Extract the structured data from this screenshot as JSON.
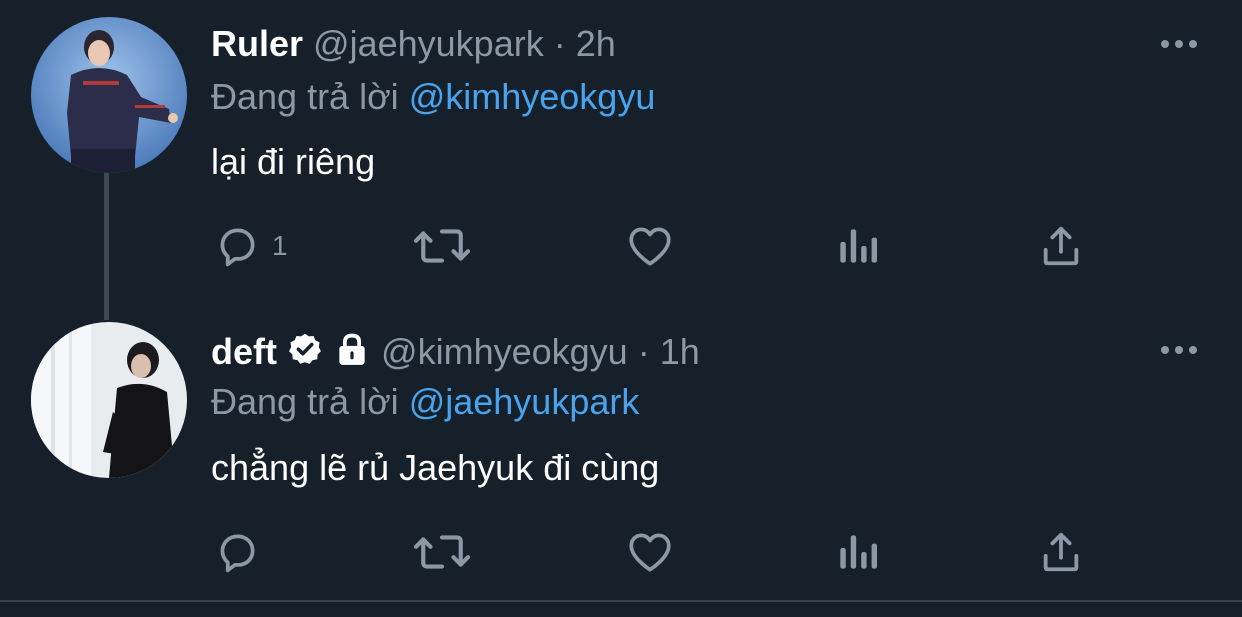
{
  "tweets": [
    {
      "name": "Ruler",
      "handle": "@jaehyukpark",
      "separator": "·",
      "time": "2h",
      "reply_prefix": "Đang trả lời",
      "reply_to": "@kimhyeokgyu",
      "text": "lại đi riêng",
      "reply_count": "1",
      "verified": false,
      "protected": false
    },
    {
      "name": "deft",
      "handle": "@kimhyeokgyu",
      "separator": "·",
      "time": "1h",
      "reply_prefix": "Đang trả lời",
      "reply_to": "@jaehyukpark",
      "text": "chẳng lẽ rủ Jaehyuk đi cùng",
      "reply_count": "",
      "verified": true,
      "protected": true
    }
  ],
  "icons": {
    "reply": "reply-icon",
    "retweet": "retweet-icon",
    "like": "heart-icon",
    "views": "views-icon",
    "share": "share-icon",
    "more": "more-icon"
  },
  "colors": {
    "background": "#15202b",
    "secondary_text": "#8b98a5",
    "mention": "#4aa3ed",
    "thread_line": "#3d4a56"
  }
}
